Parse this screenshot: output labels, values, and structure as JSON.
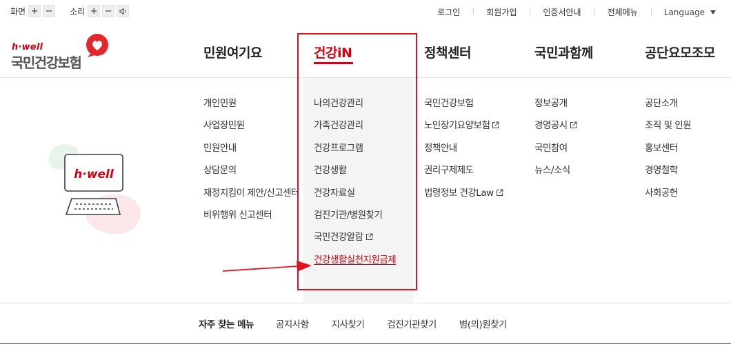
{
  "utility": {
    "screen_label": "화면",
    "sound_label": "소리",
    "plus": "+",
    "minus": "−",
    "links": [
      "로그인",
      "회원가입",
      "인증서안내",
      "전체메뉴"
    ],
    "language": "Language"
  },
  "logo": {
    "brand_en": "h·well",
    "brand_ko": "국민건강보험"
  },
  "gnb": [
    {
      "label": "민원여기요",
      "items": [
        "개인민원",
        "사업장민원",
        "민원안내",
        "상담문의",
        "재정지킴이 제안/신고센터",
        "비위행위 신고센터"
      ]
    },
    {
      "label": "건강iN",
      "items": [
        "나의건강관리",
        "가족건강관리",
        "건강프로그램",
        "건강생활",
        "건강자료실",
        "검진기관/병원찾기",
        "국민건강알람",
        "건강생활실천지원금제"
      ]
    },
    {
      "label": "정책센터",
      "items": [
        "국민건강보험",
        "노인장기요양보험",
        "정책안내",
        "권리구제제도",
        "법령정보 건강Law"
      ]
    },
    {
      "label": "국민과함께",
      "items": [
        "정보공개",
        "경영공시",
        "국민참여",
        "뉴스/소식"
      ]
    },
    {
      "label": "공단요모조모",
      "items": [
        "공단소개",
        "조직 및 인원",
        "홍보센터",
        "경영철학",
        "사회공헌"
      ]
    }
  ],
  "external_icon": "external-link-icon",
  "illustration": {
    "screen_text": "h·well"
  },
  "quick": {
    "title": "자주 찾는 메뉴",
    "items": [
      "공지사항",
      "지사찾기",
      "검진기관찾기",
      "병(의)원찾기"
    ]
  },
  "colors": {
    "accent_red": "#d7000f",
    "annotation_red": "#e0131a",
    "panel_gray": "#f4f4f4"
  }
}
